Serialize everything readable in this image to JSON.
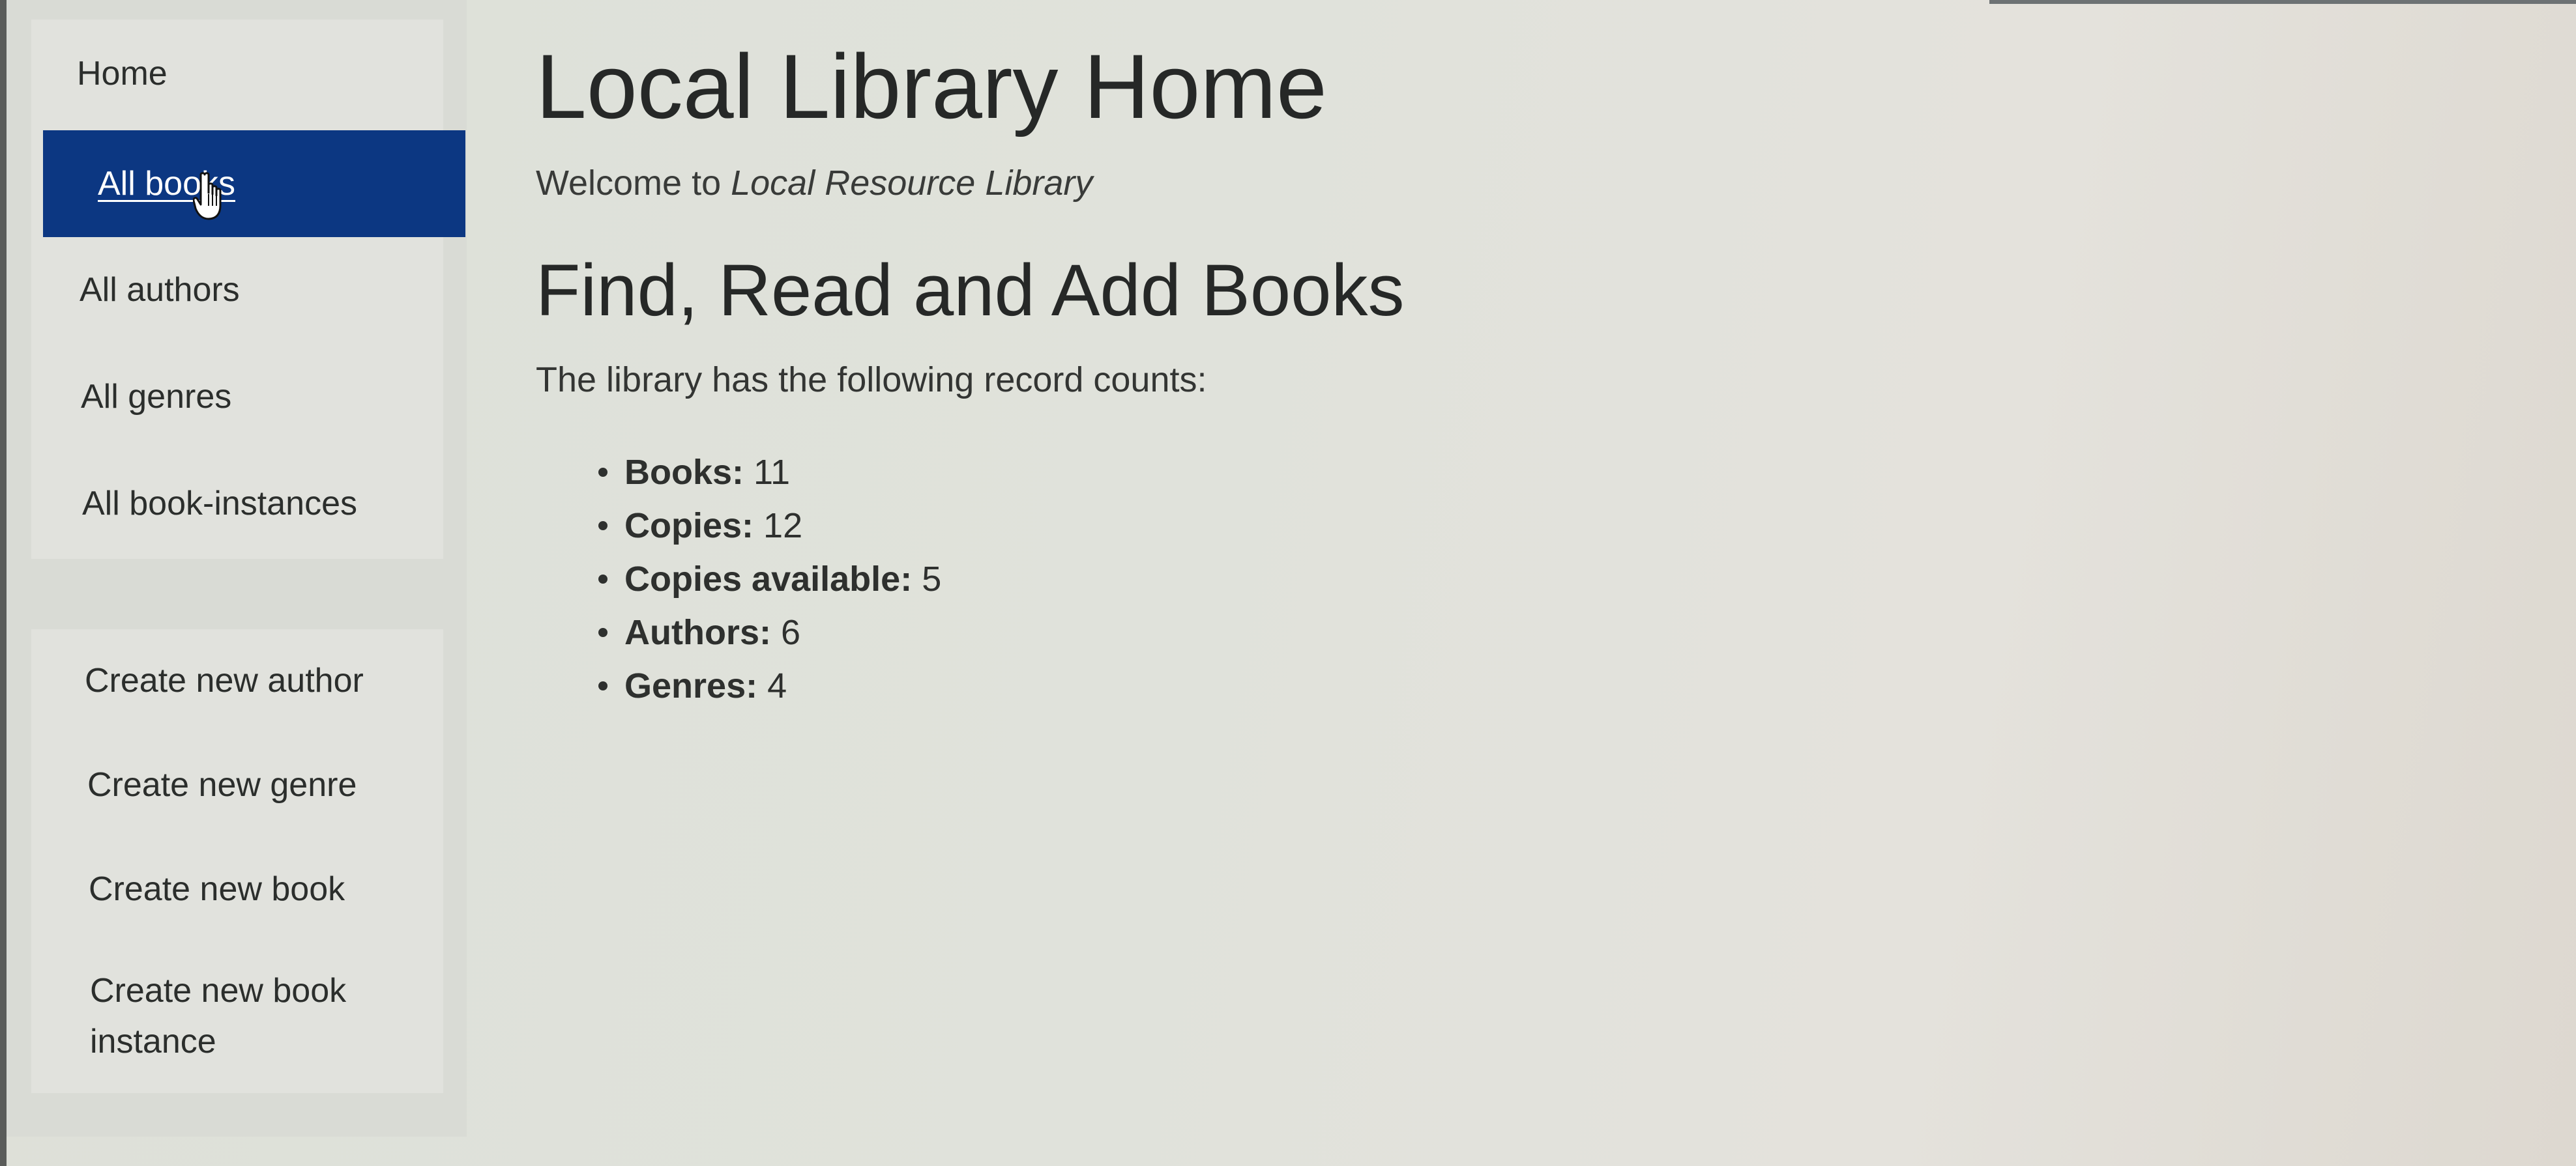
{
  "sidebar": {
    "primary": [
      {
        "label": "Home"
      },
      {
        "label": "All books"
      },
      {
        "label": "All authors"
      },
      {
        "label": "All genres"
      },
      {
        "label": "All book-instances"
      }
    ],
    "secondary": [
      {
        "label": "Create new author"
      },
      {
        "label": "Create new genre"
      },
      {
        "label": "Create new book"
      },
      {
        "label": "Create new book instance"
      }
    ],
    "active_label": "All books",
    "active_color": "#0c3782"
  },
  "main": {
    "title": "Local Library Home",
    "welcome_prefix": "Welcome to ",
    "welcome_name": "Local Resource Library",
    "section_title": "Find, Read and Add Books",
    "intro": "The library has the following record counts:",
    "counts": [
      {
        "label": "Books:",
        "value": "11"
      },
      {
        "label": "Copies:",
        "value": "12"
      },
      {
        "label": "Copies available:",
        "value": "5"
      },
      {
        "label": "Authors:",
        "value": "6"
      },
      {
        "label": "Genres:",
        "value": "4"
      }
    ]
  },
  "cursor": {
    "icon": "hand-pointer-icon"
  }
}
